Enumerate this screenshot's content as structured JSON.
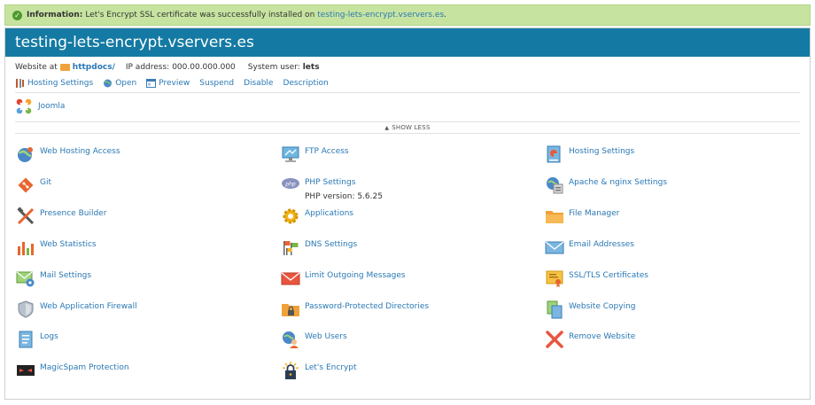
{
  "info": {
    "label": "Information:",
    "message": "Let's Encrypt SSL certificate was successfully installed on",
    "domain_link": "testing-lets-encrypt.vservers.es",
    "end": "."
  },
  "site": {
    "title": "testing-lets-encrypt.vservers.es",
    "website_at_label": "Website at",
    "docroot": "httpdocs/",
    "ip_label": "IP address:",
    "ip": "000.00.000.000",
    "user_label": "System user:",
    "user": "lets"
  },
  "actions": [
    {
      "label": "Hosting Settings"
    },
    {
      "label": "Open"
    },
    {
      "label": "Preview"
    },
    {
      "label": "Suspend"
    },
    {
      "label": "Disable"
    },
    {
      "label": "Description"
    }
  ],
  "app": {
    "label": "Joomla"
  },
  "toggle": {
    "label": "SHOW LESS"
  },
  "tools": [
    {
      "name": "Web Hosting Access",
      "icon": "globe-person-icon"
    },
    {
      "name": "FTP Access",
      "icon": "ftp-monitor-icon"
    },
    {
      "name": "Hosting Settings",
      "icon": "hosting-settings-icon"
    },
    {
      "name": "Git",
      "icon": "git-icon"
    },
    {
      "name": "PHP Settings",
      "sub": "PHP version: 5.6.25",
      "icon": "php-icon"
    },
    {
      "name": "Apache & nginx Settings",
      "icon": "apache-nginx-icon"
    },
    {
      "name": "Presence Builder",
      "icon": "hammer-wrench-icon"
    },
    {
      "name": "Applications",
      "icon": "gear-icon"
    },
    {
      "name": "File Manager",
      "icon": "folder-icon"
    },
    {
      "name": "Web Statistics",
      "icon": "bar-chart-icon"
    },
    {
      "name": "DNS Settings",
      "icon": "dns-flags-icon"
    },
    {
      "name": "Email Addresses",
      "icon": "envelope-icon"
    },
    {
      "name": "Mail Settings",
      "icon": "mail-settings-icon"
    },
    {
      "name": "Limit Outgoing Messages",
      "icon": "red-envelope-icon"
    },
    {
      "name": "SSL/TLS Certificates",
      "icon": "certificate-icon"
    },
    {
      "name": "Web Application Firewall",
      "icon": "shield-icon"
    },
    {
      "name": "Password-Protected Directories",
      "icon": "locked-folder-icon"
    },
    {
      "name": "Website Copying",
      "icon": "copy-pages-icon"
    },
    {
      "name": "Logs",
      "icon": "log-document-icon"
    },
    {
      "name": "Web Users",
      "icon": "web-users-icon"
    },
    {
      "name": "Remove Website",
      "icon": "red-x-icon"
    },
    {
      "name": "MagicSpam Protection",
      "icon": "magicspam-mask-icon"
    },
    {
      "name": "Let's Encrypt",
      "icon": "lets-encrypt-lock-icon"
    }
  ],
  "colors": {
    "info_bg": "#c7e3a0",
    "title_bg": "#147aa3",
    "link": "#2a78b4"
  }
}
